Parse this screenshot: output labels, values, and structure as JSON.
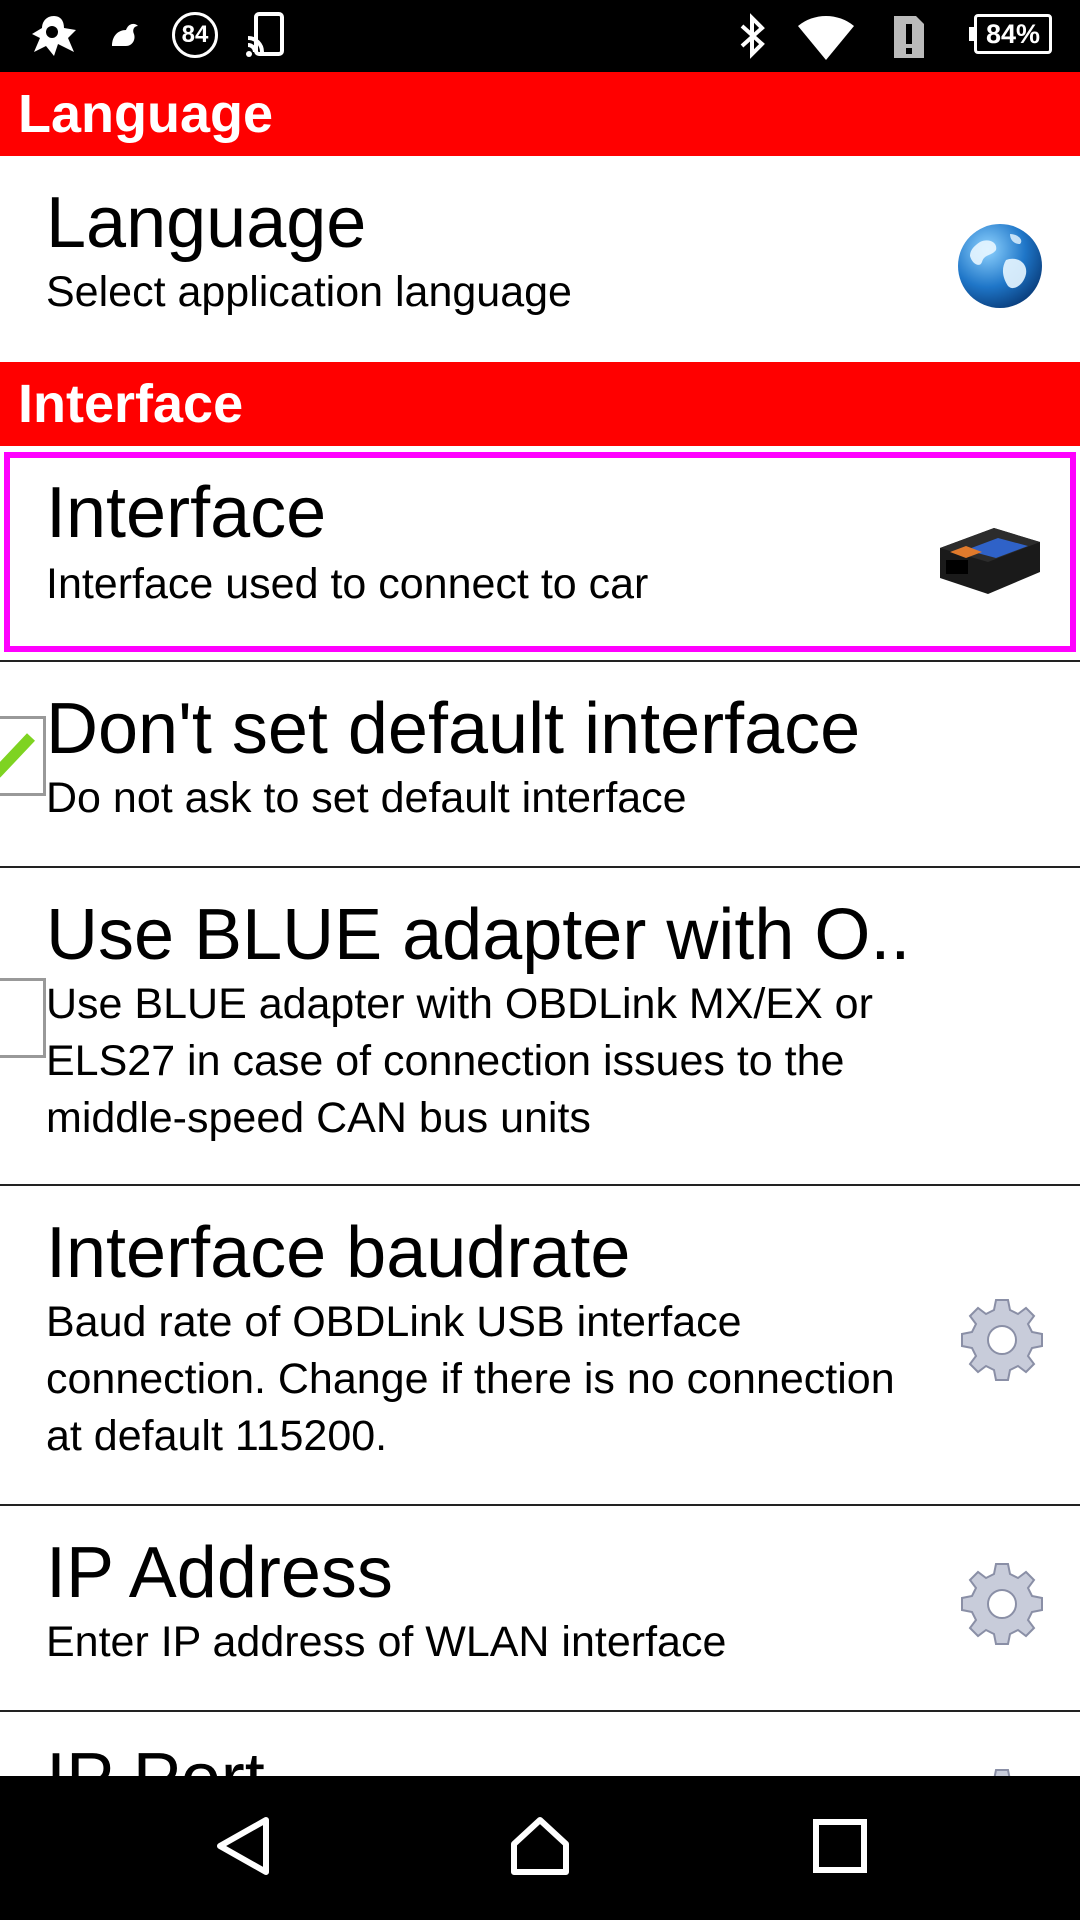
{
  "status_bar": {
    "left_icons": [
      "app-icon",
      "notification-icon",
      "count-84-icon",
      "cast-icon"
    ],
    "notification_count": "84",
    "right_icons": [
      "bluetooth-icon",
      "wifi-icon",
      "alert-icon"
    ],
    "battery": "84%"
  },
  "categories": {
    "language": "Language",
    "interface": "Interface"
  },
  "prefs": {
    "language": {
      "title": "Language",
      "summary": "Select application language",
      "icon": "globe-icon"
    },
    "interface": {
      "title": "Interface",
      "summary": "Interface used to connect to car",
      "icon": "obd-adapter-icon"
    },
    "no_default": {
      "title": "Don't set default interface",
      "summary": "Do not ask to set default interface",
      "checked": true
    },
    "blue_adapter": {
      "title": "Use BLUE adapter with O..",
      "summary": "Use BLUE adapter with OBDLink MX/EX or ELS27 in case of connection issues to the middle-speed CAN bus units",
      "checked": false
    },
    "baudrate": {
      "title": "Interface baudrate",
      "summary": "Baud rate of OBDLink USB interface connection. Change if there is no connection at default 115200.",
      "icon": "gear-icon"
    },
    "ip_address": {
      "title": "IP Address",
      "summary": "Enter IP address of WLAN interface",
      "icon": "gear-icon"
    },
    "ip_port": {
      "title": "IP Port",
      "icon": "gear-icon"
    }
  },
  "nav_bar": {
    "buttons": [
      "back-icon",
      "home-icon",
      "recents-icon"
    ]
  },
  "colors": {
    "category_header": "#ff0000",
    "highlight_border": "#ff00ff",
    "check_green": "#7ed321"
  }
}
